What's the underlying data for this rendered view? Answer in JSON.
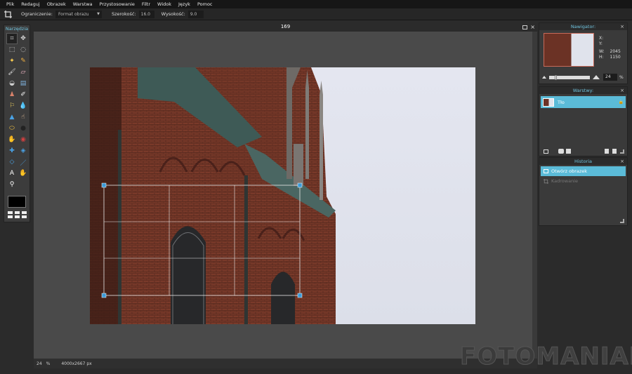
{
  "menu": [
    "Plik",
    "Redaguj",
    "Obrazek",
    "Warstwa",
    "Przystosowanie",
    "Filtr",
    "Widok",
    "Język",
    "Pomoc"
  ],
  "options": {
    "constraint_label": "Ograniczenie:",
    "constraint_value": "Format obrazu",
    "width_label": "Szerokość:",
    "width_value": "16.0",
    "height_label": "Wysokość:",
    "height_value": "9.0"
  },
  "tools": {
    "title": "Narzędzia",
    "items": [
      "crop-icon",
      "move-icon",
      "marquee-icon",
      "lasso-icon",
      "wand-icon",
      "pencil-icon",
      "brush-icon",
      "eraser-icon",
      "bucket-icon",
      "gradient-icon",
      "stamp-icon",
      "picker-icon",
      "replace-icon",
      "drop-icon",
      "sharpen-icon",
      "smudge-icon",
      "sponge-icon",
      "dodge-icon",
      "burn-icon",
      "redeye-icon",
      "spotheal-icon",
      "bloat-icon",
      "pinch-icon",
      "line-icon",
      "text-icon",
      "hand-icon",
      "zoom-icon"
    ]
  },
  "document": {
    "title": "169",
    "zoom": "24",
    "zoom_unit": "%",
    "dimensions": "4000x2667 px"
  },
  "navigator": {
    "title": "Nawigator:",
    "x_label": "X:",
    "y_label": "Y:",
    "w_label": "W:",
    "w_value": "2045",
    "h_label": "H:",
    "h_value": "1150",
    "zoom": "24",
    "zoom_unit": "%"
  },
  "layers": {
    "title": "Warstwy:",
    "items": [
      {
        "name": "Tło"
      }
    ]
  },
  "history": {
    "title": "Historia",
    "items": [
      "Otwórz obrazek",
      "Kadrowanie"
    ]
  },
  "watermark": {
    "part1": "FOTO",
    "part2": "MANIAK"
  },
  "crop": {
    "ratio": "16:9"
  },
  "colors": {
    "accent": "#5bbbd8",
    "title": "#6fc3de"
  }
}
